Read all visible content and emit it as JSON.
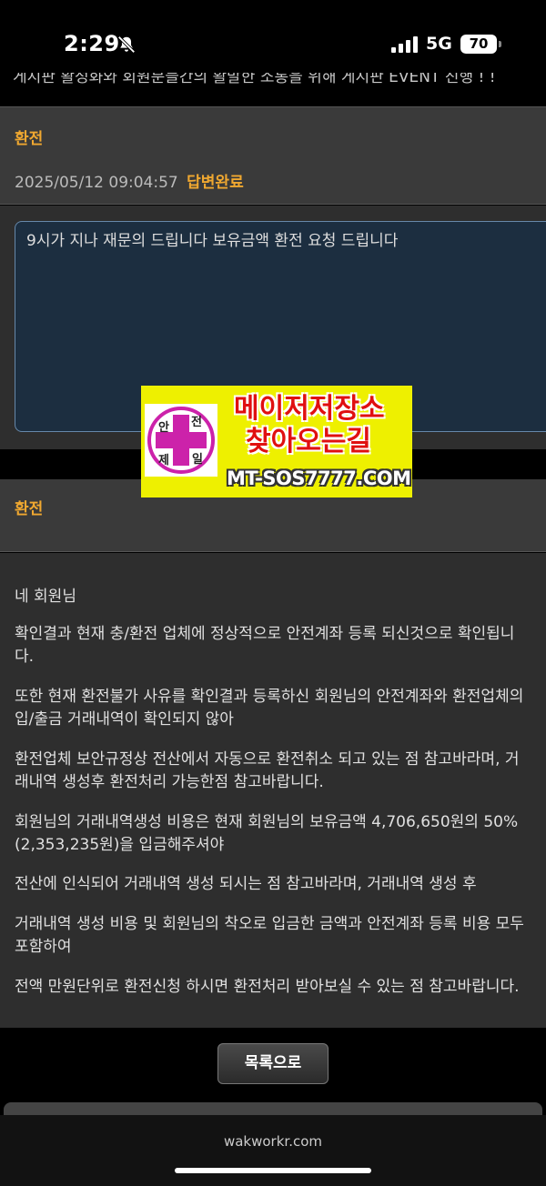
{
  "status_bar": {
    "time": "2:29",
    "network": "5G",
    "battery": "70"
  },
  "top_cut_text": "게시판 활성화와 회원분들간의 활발한 소통을 위해 게시판 EVENT 진행 ! !",
  "question": {
    "category": "환전",
    "date": "2025/05/12 09:04:57",
    "status": "답변완료",
    "body": "9시가 지나 재문의 드립니다 보유금액 환전 요청 드립니다"
  },
  "answer": {
    "category": "환전",
    "paragraphs": [
      "네 회원님",
      "확인결과 현재 충/환전 업체에 정상적으로 안전계좌 등록 되신것으로 확인됩니다.",
      "또한 현재 환전불가 사유를 확인결과 등록하신 회원님의 안전계좌와 환전업체의 입/출금 거래내역이 확인되지 않아",
      "환전업체 보안규정상 전산에서 자동으로 환전취소 되고 있는 점 참고바라며, 거래내역 생성후 환전처리 가능한점 참고바랍니다.",
      "회원님의 거래내역생성 비용은 현재 회원님의 보유금액 4,706,650원의 50%(2,353,235원)을 입금해주셔야",
      "전산에 인식되어 거래내역 생성 되시는 점 참고바라며, 거래내역 생성 후",
      "거래내역 생성 비용 및 회원님의 착오로 입금한 금액과 안전계좌 등록 비용 모두 포함하여",
      "전액 만원단위로 환전신청 하시면 환전처리 받아보실 수 있는 점 참고바랍니다."
    ]
  },
  "ad": {
    "logo_chars": [
      "안",
      "전",
      "제",
      "일"
    ],
    "line1": "메이저저장소",
    "line2": "찾아오는길",
    "url": "MT-SOS7777.COM"
  },
  "list_button": "목록으로",
  "browser_url": "wakworkr.com",
  "colors": {
    "accent": "#f0a830",
    "question_bg": "#1c2e40",
    "ad_bg": "#eef000",
    "ad_text": "#e01010",
    "logo": "#cc22aa"
  }
}
